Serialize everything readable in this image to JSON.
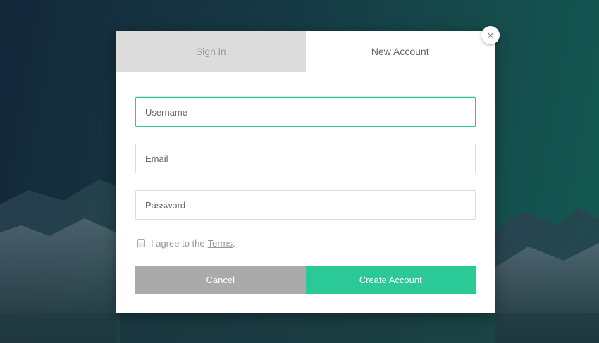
{
  "tabs": {
    "signin_label": "Sign in",
    "new_account_label": "New Account"
  },
  "close": {
    "glyph": "×"
  },
  "form": {
    "username_placeholder": "Username",
    "email_placeholder": "Email",
    "password_placeholder": "Password",
    "terms_prefix": "I agree to the",
    "terms_link": "Terms",
    "terms_suffix": "."
  },
  "buttons": {
    "cancel_label": "Cancel",
    "create_label": "Create Account"
  },
  "colors": {
    "accent": "#2bc995",
    "cancel": "#aaaaaa",
    "inactive_tab": "#dcdcdc"
  },
  "icons": {
    "close": "close-icon"
  }
}
